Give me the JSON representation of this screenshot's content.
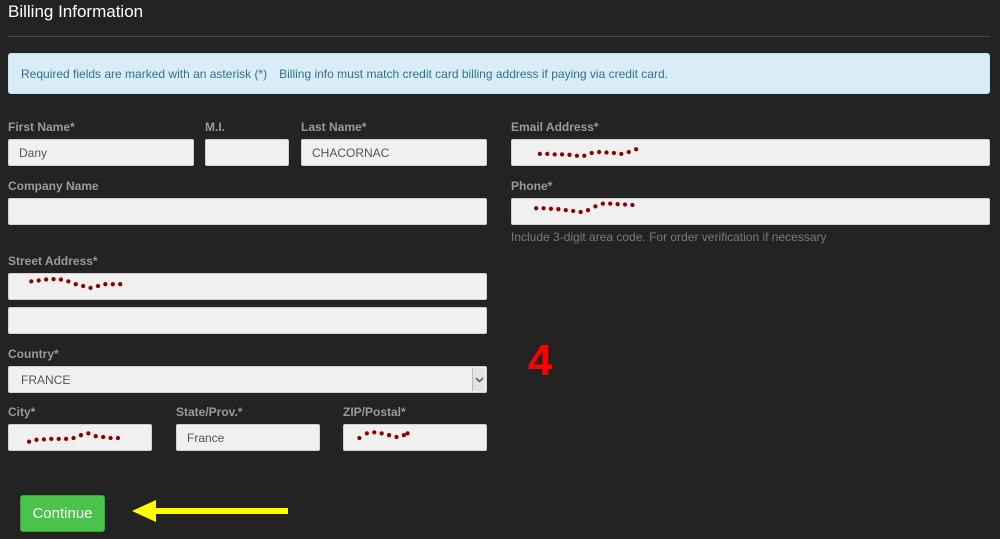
{
  "page": {
    "title": "Billing Information"
  },
  "alert": {
    "required_note": "Required fields are marked with an asterisk (*)",
    "billing_note": "Billing info must match credit card billing address if paying via credit card."
  },
  "form": {
    "first_name": {
      "label": "First Name*",
      "value": "Dany"
    },
    "middle_initial": {
      "label": "M.I.",
      "value": ""
    },
    "last_name": {
      "label": "Last Name*",
      "value": "CHACORNAC"
    },
    "email": {
      "label": "Email Address*",
      "value": ""
    },
    "company": {
      "label": "Company Name",
      "value": ""
    },
    "phone": {
      "label": "Phone*",
      "value": "",
      "help": "Include 3-digit area code. For order verification if necessary"
    },
    "street": {
      "label": "Street Address*",
      "value": "",
      "value2": ""
    },
    "country": {
      "label": "Country*",
      "value": "FRANCE"
    },
    "city": {
      "label": "City*",
      "value": ""
    },
    "state": {
      "label": "State/Prov.*",
      "value": "France"
    },
    "zip": {
      "label": "ZIP/Postal*",
      "value": ""
    }
  },
  "annotations": {
    "step_number": "4",
    "colors": {
      "marker": "#ff0000",
      "arrow": "#ffff00",
      "redaction": "#8b0000"
    }
  },
  "actions": {
    "continue_label": "Continue"
  }
}
